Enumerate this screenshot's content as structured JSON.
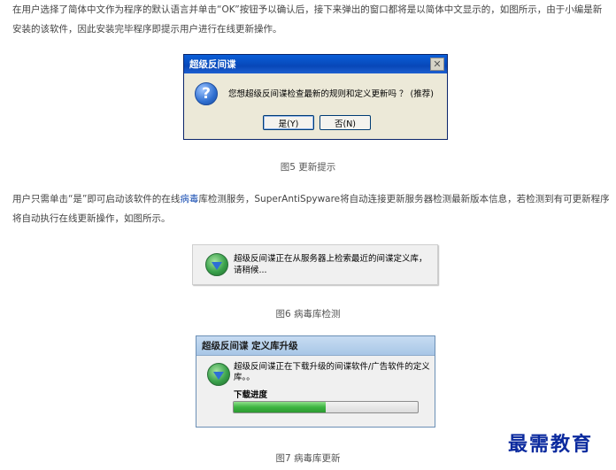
{
  "article": {
    "para1": "在用户选择了简体中文作为程序的默认语言并单击“OK”按钮予以确认后，接下来弹出的窗口都将是以简体中文显示的，如图所示，由于小编是新安装的该软件，因此安装完毕程序即提示用户进行在线更新操作。",
    "para2_before": "用户只需单击“是”即可启动该软件的在线",
    "para2_link": "病毒",
    "para2_after": "库检测服务，SuperAntiSpyware将自动连接更新服务器检测最新版本信息，若检测到有可更新程序将自动执行在线更新操作，如图所示。",
    "caption5": "图5 更新提示",
    "caption6": "图6 病毒库检测",
    "caption7": "图7 病毒库更新"
  },
  "dialog_update_prompt": {
    "title": "超级反间谍",
    "icon": "question-icon",
    "message": "您想超级反间谍检查最新的规则和定义更新吗 ？  (推荐)",
    "yes_label": "是(Y)",
    "no_label": "否(N)"
  },
  "dialog_checking": {
    "icon": "globe-download-icon",
    "message": "超级反间谍正在从服务器上检索最近的间谍定义库，请稍候..."
  },
  "dialog_upgrade": {
    "title": "超级反间谍 定义库升级",
    "icon": "globe-download-icon",
    "message": "超级反间谍正在下载升级的间谍软件/广告软件的定义库。。",
    "progress_label": "下载进度",
    "progress": 0.5
  },
  "watermark": "最需教育"
}
